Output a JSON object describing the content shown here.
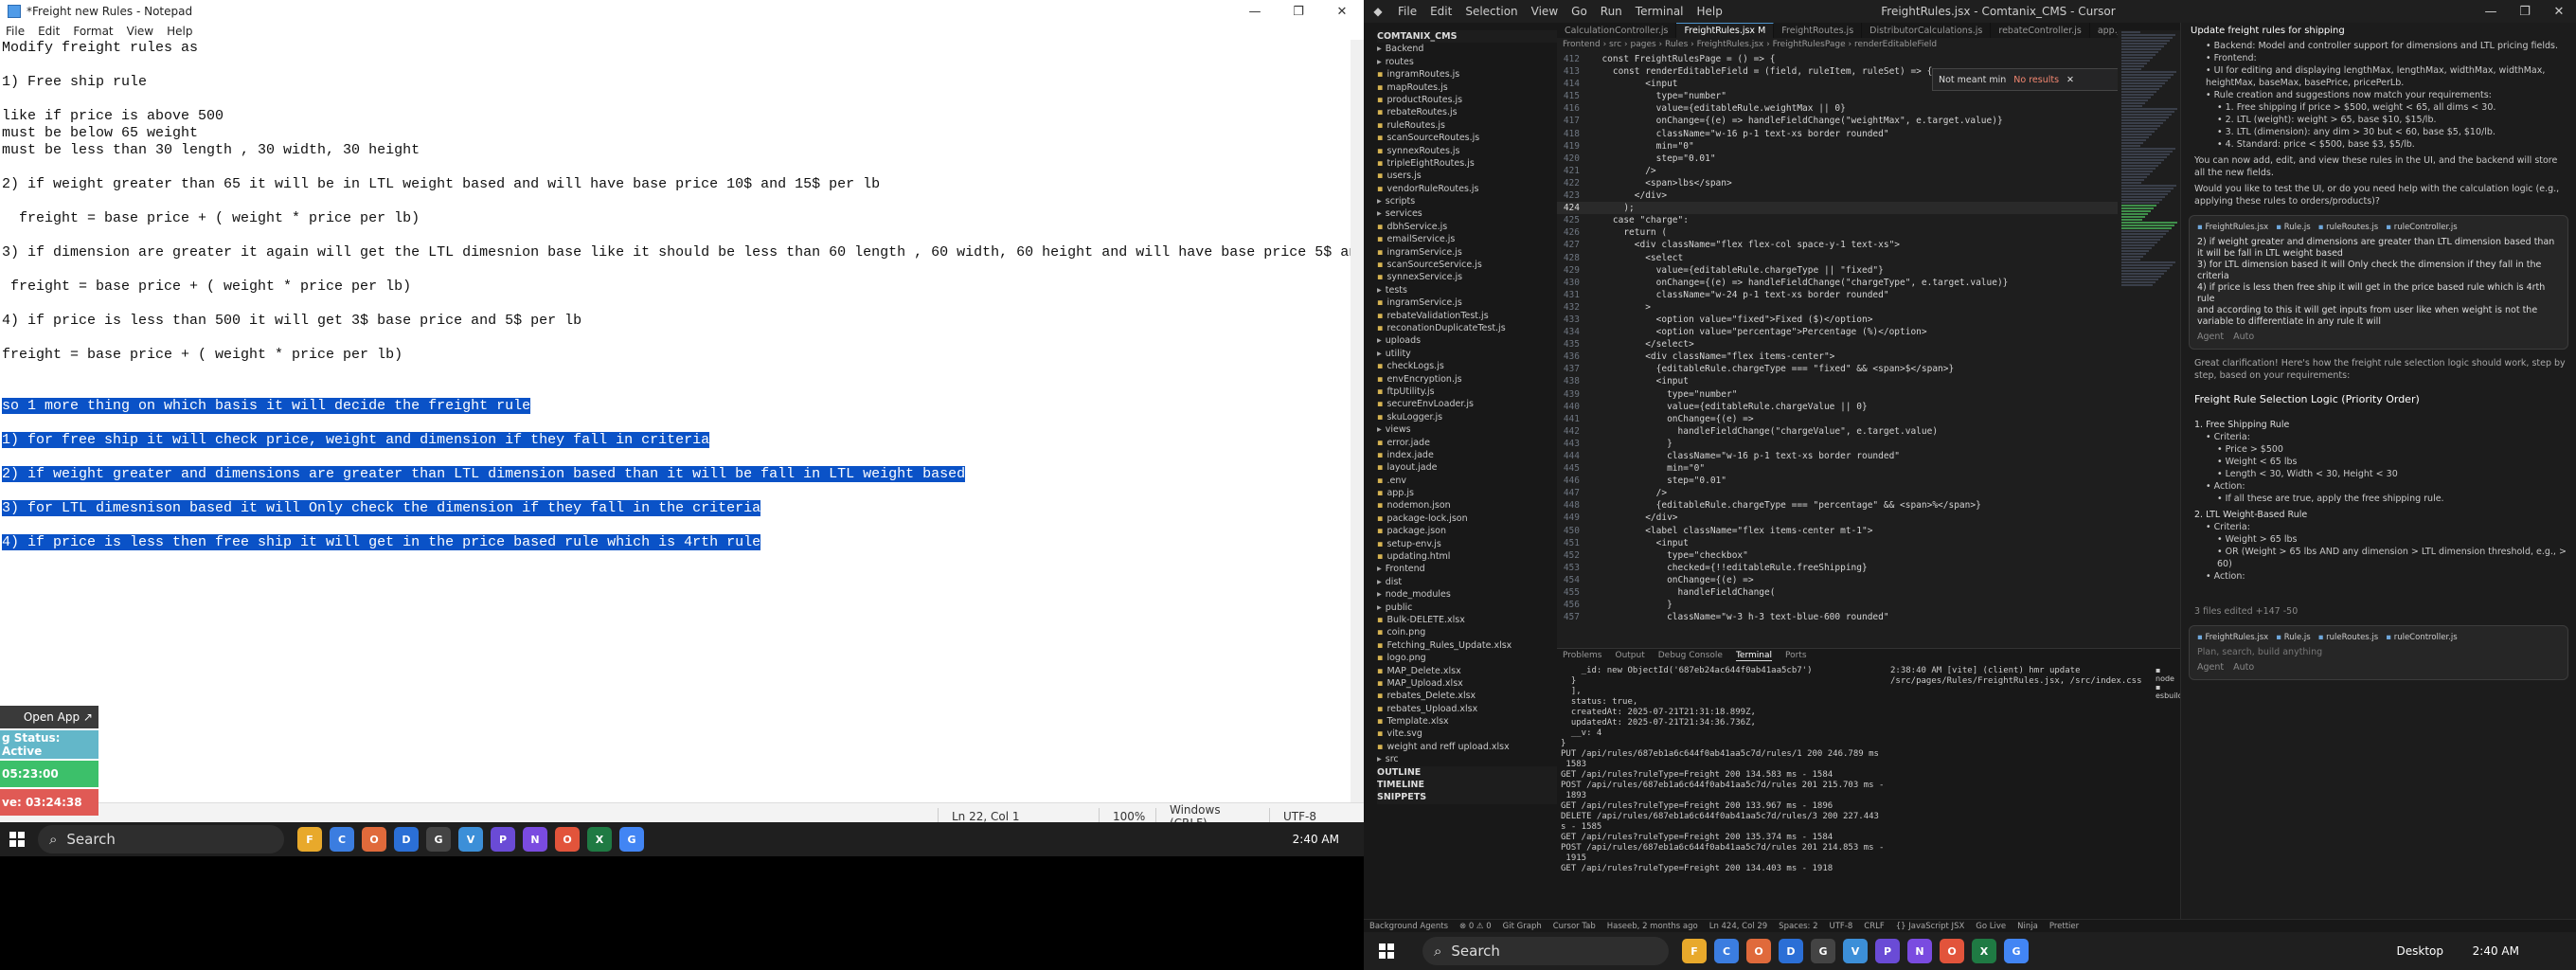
{
  "notepad": {
    "title": "*Freight new Rules - Notepad",
    "menu": [
      "File",
      "Edit",
      "Format",
      "View",
      "Help"
    ],
    "lines": [
      {
        "text": "Modify freight rules as",
        "selected": false
      },
      {
        "text": "",
        "selected": false
      },
      {
        "text": "1) Free ship rule",
        "selected": false
      },
      {
        "text": "",
        "selected": false
      },
      {
        "text": "like if price is above 500",
        "selected": false
      },
      {
        "text": "must be below 65 weight",
        "selected": false
      },
      {
        "text": "must be less than 30 length , 30 width, 30 height",
        "selected": false
      },
      {
        "text": "",
        "selected": false
      },
      {
        "text": "2) if weight greater than 65 it will be in LTL weight based and will have base price 10$ and 15$ per lb",
        "selected": false
      },
      {
        "text": "",
        "selected": false
      },
      {
        "text": "  freight = base price + ( weight * price per lb)",
        "selected": false
      },
      {
        "text": "",
        "selected": false
      },
      {
        "text": "3) if dimension are greater it again will get the LTL dimesnion base like it should be less than 60 length , 60 width, 60 height and will have base price 5$ and 10$ per lb",
        "selected": false
      },
      {
        "text": "",
        "selected": false
      },
      {
        "text": " freight = base price + ( weight * price per lb)",
        "selected": false
      },
      {
        "text": "",
        "selected": false
      },
      {
        "text": "4) if price is less than 500 it will get 3$ base price and 5$ per lb",
        "selected": false
      },
      {
        "text": "",
        "selected": false
      },
      {
        "text": "freight = base price + ( weight * price per lb)",
        "selected": false
      },
      {
        "text": "",
        "selected": false
      },
      {
        "text": "",
        "selected": false
      },
      {
        "text": "so 1 more thing on which basis it will decide the freight rule",
        "selected": true
      },
      {
        "text": "",
        "selected": false
      },
      {
        "text": "1) for free ship it will check price, weight and dimension if they fall in criteria",
        "selected": true
      },
      {
        "text": "",
        "selected": false
      },
      {
        "text": "2) if weight greater and dimensions are greater than LTL dimension based than it will be fall in LTL weight based",
        "selected": true
      },
      {
        "text": "",
        "selected": false
      },
      {
        "text": "3) for LTL dimesnison based it will Only check the dimension if they fall in the criteria",
        "selected": true
      },
      {
        "text": "",
        "selected": false
      },
      {
        "text": "4) if price is less then free ship it will get in the price based rule which is 4rth rule",
        "selected": true
      }
    ],
    "status": {
      "position": "Ln 22, Col 1",
      "zoom": "100%",
      "eol": "Windows (CRLF)",
      "encoding": "UTF-8"
    }
  },
  "widget": {
    "open_app": "Open App ↗",
    "status": "g Status: Active",
    "time_green": "05:23:00",
    "time_red": "ve: 03:24:38"
  },
  "left_taskbar": {
    "search": "Search",
    "clock": "2:40 AM",
    "apps": [
      {
        "label": "F",
        "color": "#e8a92b"
      },
      {
        "label": "C",
        "color": "#3b7de0"
      },
      {
        "label": "O",
        "color": "#e06a3b"
      },
      {
        "label": "D",
        "color": "#2b6fd6"
      },
      {
        "label": "G",
        "color": "#444444"
      },
      {
        "label": "V",
        "color": "#3c8fd8"
      },
      {
        "label": "P",
        "color": "#6a4bd6"
      },
      {
        "label": "N",
        "color": "#7a4be0"
      },
      {
        "label": "O",
        "color": "#e2543b"
      },
      {
        "label": "X",
        "color": "#1f7a43"
      },
      {
        "label": "G",
        "color": "#4285f4"
      }
    ]
  },
  "cursor": {
    "menu": [
      "File",
      "Edit",
      "Selection",
      "View",
      "Go",
      "Run",
      "Terminal",
      "Help"
    ],
    "title": "FreightRules.jsx - Comtanix_CMS - Cursor",
    "tabs": [
      {
        "label": "CalculationController.js",
        "active": false
      },
      {
        "label": "FreightRules.jsx M",
        "active": true
      },
      {
        "label": "FreightRoutes.js",
        "active": false
      },
      {
        "label": "DistributorCalculations.js",
        "active": false
      },
      {
        "label": "rebateController.js",
        "active": false
      },
      {
        "label": "app.js",
        "active": false
      }
    ],
    "breadcrumb": "Frontend › src › pages › Rules › FreightRules.jsx › FreightRulesPage › renderEditableField",
    "find_text": "Not meant min",
    "find_result": "No results",
    "code": [
      {
        "n": "412",
        "t": "  const FreightRulesPage = () => {"
      },
      {
        "n": "413",
        "t": "    const renderEditableField = (field, ruleItem, ruleSet) => {"
      },
      {
        "n": "414",
        "t": "          <input"
      },
      {
        "n": "415",
        "t": "            type=\"number\""
      },
      {
        "n": "416",
        "t": "            value={editableRule.weightMax || 0}"
      },
      {
        "n": "417",
        "t": "            onChange={(e) => handleFieldChange(\"weightMax\", e.target.value)}"
      },
      {
        "n": "418",
        "t": "            className=\"w-16 p-1 text-xs border rounded\""
      },
      {
        "n": "419",
        "t": "            min=\"0\""
      },
      {
        "n": "420",
        "t": "            step=\"0.01\""
      },
      {
        "n": "421",
        "t": "          />"
      },
      {
        "n": "422",
        "t": "          <span>lbs</span>"
      },
      {
        "n": "423",
        "t": "        </div>"
      },
      {
        "n": "424",
        "t": "      );"
      },
      {
        "n": "425",
        "t": "    case \"charge\":"
      },
      {
        "n": "426",
        "t": "      return ("
      },
      {
        "n": "427",
        "t": "        <div className=\"flex flex-col space-y-1 text-xs\">"
      },
      {
        "n": "428",
        "t": "          <select"
      },
      {
        "n": "429",
        "t": "            value={editableRule.chargeType || \"fixed\"}"
      },
      {
        "n": "430",
        "t": "            onChange={(e) => handleFieldChange(\"chargeType\", e.target.value)}"
      },
      {
        "n": "431",
        "t": "            className=\"w-24 p-1 text-xs border rounded\""
      },
      {
        "n": "432",
        "t": "          >"
      },
      {
        "n": "433",
        "t": "            <option value=\"fixed\">Fixed ($)</option>"
      },
      {
        "n": "434",
        "t": "            <option value=\"percentage\">Percentage (%)</option>"
      },
      {
        "n": "435",
        "t": "          </select>"
      },
      {
        "n": "436",
        "t": "          <div className=\"flex items-center\">"
      },
      {
        "n": "437",
        "t": "            {editableRule.chargeType === \"fixed\" && <span>$</span>}"
      },
      {
        "n": "438",
        "t": "            <input"
      },
      {
        "n": "439",
        "t": "              type=\"number\""
      },
      {
        "n": "440",
        "t": "              value={editableRule.chargeValue || 0}"
      },
      {
        "n": "441",
        "t": "              onChange={(e) =>"
      },
      {
        "n": "442",
        "t": "                handleFieldChange(\"chargeValue\", e.target.value)"
      },
      {
        "n": "443",
        "t": "              }"
      },
      {
        "n": "444",
        "t": "              className=\"w-16 p-1 text-xs border rounded\""
      },
      {
        "n": "445",
        "t": "              min=\"0\""
      },
      {
        "n": "446",
        "t": "              step=\"0.01\""
      },
      {
        "n": "447",
        "t": "            />"
      },
      {
        "n": "448",
        "t": "            {editableRule.chargeType === \"percentage\" && <span>%</span>}"
      },
      {
        "n": "449",
        "t": "          </div>"
      },
      {
        "n": "450",
        "t": "          <label className=\"flex items-center mt-1\">"
      },
      {
        "n": "451",
        "t": "            <input"
      },
      {
        "n": "452",
        "t": "              type=\"checkbox\""
      },
      {
        "n": "453",
        "t": "              checked={!!editableRule.freeShipping}"
      },
      {
        "n": "454",
        "t": "              onChange={(e) =>"
      },
      {
        "n": "455",
        "t": "                handleFieldChange("
      },
      {
        "n": "456",
        "t": "              }"
      },
      {
        "n": "457",
        "t": "              className=\"w-3 h-3 text-blue-600 rounded\""
      }
    ],
    "explorer": [
      {
        "t": "COMTANIX_CMS",
        "k": "section"
      },
      {
        "t": "Backend",
        "k": "folder"
      },
      {
        "t": "routes",
        "k": "folder"
      },
      {
        "t": "ingramRoutes.js",
        "k": "file"
      },
      {
        "t": "mapRoutes.js",
        "k": "file"
      },
      {
        "t": "productRoutes.js",
        "k": "file"
      },
      {
        "t": "rebateRoutes.js",
        "k": "file"
      },
      {
        "t": "ruleRoutes.js",
        "k": "file"
      },
      {
        "t": "scanSourceRoutes.js",
        "k": "file"
      },
      {
        "t": "synnexRoutes.js",
        "k": "file"
      },
      {
        "t": "tripleEightRoutes.js",
        "k": "file"
      },
      {
        "t": "users.js",
        "k": "file"
      },
      {
        "t": "vendorRuleRoutes.js",
        "k": "file"
      },
      {
        "t": "scripts",
        "k": "folder"
      },
      {
        "t": "services",
        "k": "folder"
      },
      {
        "t": "dbhService.js",
        "k": "file"
      },
      {
        "t": "emailService.js",
        "k": "file"
      },
      {
        "t": "ingramService.js",
        "k": "file"
      },
      {
        "t": "scanSourceService.js",
        "k": "file"
      },
      {
        "t": "synnexService.js",
        "k": "file"
      },
      {
        "t": "tests",
        "k": "folder"
      },
      {
        "t": "ingramService.js",
        "k": "file"
      },
      {
        "t": "rebateValidationTest.js",
        "k": "file"
      },
      {
        "t": "reconationDuplicateTest.js",
        "k": "file"
      },
      {
        "t": "uploads",
        "k": "folder"
      },
      {
        "t": "utility",
        "k": "folder"
      },
      {
        "t": "checkLogs.js",
        "k": "file"
      },
      {
        "t": "envEncryption.js",
        "k": "file"
      },
      {
        "t": "ftpUtility.js",
        "k": "file"
      },
      {
        "t": "secureEnvLoader.js",
        "k": "file"
      },
      {
        "t": "skuLogger.js",
        "k": "file"
      },
      {
        "t": "views",
        "k": "folder"
      },
      {
        "t": "error.jade",
        "k": "file"
      },
      {
        "t": "index.jade",
        "k": "file"
      },
      {
        "t": "layout.jade",
        "k": "file"
      },
      {
        "t": ".env",
        "k": "file"
      },
      {
        "t": "app.js",
        "k": "file"
      },
      {
        "t": "nodemon.json",
        "k": "file"
      },
      {
        "t": "package-lock.json",
        "k": "file"
      },
      {
        "t": "package.json",
        "k": "file"
      },
      {
        "t": "setup-env.js",
        "k": "file"
      },
      {
        "t": "updating.html",
        "k": "file"
      },
      {
        "t": "Frontend",
        "k": "folder"
      },
      {
        "t": "dist",
        "k": "folder"
      },
      {
        "t": "node_modules",
        "k": "folder"
      },
      {
        "t": "public",
        "k": "folder"
      },
      {
        "t": "Bulk-DELETE.xlsx",
        "k": "file"
      },
      {
        "t": "coin.png",
        "k": "file"
      },
      {
        "t": "Fetching_Rules_Update.xlsx",
        "k": "file"
      },
      {
        "t": "logo.png",
        "k": "file"
      },
      {
        "t": "MAP_Delete.xlsx",
        "k": "file"
      },
      {
        "t": "MAP_Upload.xlsx",
        "k": "file"
      },
      {
        "t": "rebates_Delete.xlsx",
        "k": "file"
      },
      {
        "t": "rebates_Upload.xlsx",
        "k": "file"
      },
      {
        "t": "Template.xlsx",
        "k": "file"
      },
      {
        "t": "vite.svg",
        "k": "file"
      },
      {
        "t": "weight and reff upload.xlsx",
        "k": "file"
      },
      {
        "t": "src",
        "k": "folder"
      },
      {
        "t": "OUTLINE",
        "k": "section"
      },
      {
        "t": "TIMELINE",
        "k": "section"
      },
      {
        "t": "SNIPPETS",
        "k": "section"
      }
    ],
    "panel_tabs": [
      "Problems",
      "Output",
      "Debug Console",
      "Terminal",
      "Ports"
    ],
    "terminal_left": [
      "    _id: new ObjectId('687eb24ac644f0ab41aa5cb7')",
      "  }",
      "  ],",
      "  status: true,",
      "  createdAt: 2025-07-21T21:31:18.899Z,",
      "  updatedAt: 2025-07-21T21:34:36.736Z,",
      "  __v: 4",
      "}",
      "PUT /api/rules/687eb1a6c644f0ab41aa5c7d/rules/1 200 246.789 ms -",
      " 1583",
      "GET /api/rules?ruleType=Freight 200 134.583 ms - 1584",
      "POST /api/rules/687eb1a6c644f0ab41aa5c7d/rules 201 215.703 ms -",
      " 1893",
      "GET /api/rules?ruleType=Freight 200 133.967 ms - 1896",
      "DELETE /api/rules/687eb1a6c644f0ab41aa5c7d/rules/3 200 227.443 m",
      "s - 1585",
      "GET /api/rules?ruleType=Freight 200 135.374 ms - 1584",
      "POST /api/rules/687eb1a6c644f0ab41aa5c7d/rules 201 214.853 ms -",
      " 1915",
      "GET /api/rules?ruleType=Freight 200 134.403 ms - 1918"
    ],
    "terminal_right": "2:38:40 AM [vite] (client) hmr update /src/pages/Rules/FreightRules.jsx, /src/index.css",
    "chat": {
      "title": "Update freight rules for shipping",
      "summary": [
        "Backend: Model and controller support for dimensions and LTL pricing fields.",
        "Frontend:",
        "UI for editing and displaying lengthMax, lengthMax, widthMax, widthMax, heightMax, baseMax, basePrice, pricePerLb.",
        "Rule creation and suggestions now match your requirements:",
        "1. Free shipping if price > $500, weight < 65, all dims < 30.",
        "2. LTL (weight): weight > 65, base $10, $15/lb.",
        "3. LTL (dimension): any dim > 30 but < 60, base $5, $10/lb.",
        "4. Standard: price < $500, base $3, $5/lb."
      ],
      "note": "You can now add, edit, and view these rules in the UI, and the backend will store all the new fields.",
      "question": "Would you like to test the UI, or do you need help with the calculation logic (e.g., applying these rules to orders/products)?",
      "input_lines": [
        "2) if weight greater and dimensions are greater than LTL dimension based than it will be fall in LTL weight based",
        "3) for LTL dimension based it will Only check the dimension if they fall in the criteria",
        "4) if price is less then free ship it will get in the price based rule which is 4rth rule",
        "and according to this it will get inputs from user like when weight is not the variable to differentiate in any rule it will"
      ],
      "chips": [
        "FreightRules.jsx",
        "Rule.js",
        "ruleRoutes.js",
        "ruleController.js"
      ],
      "answer_intro": "Great clarification! Here's how the freight rule selection logic should work, step by step, based on your requirements:",
      "answer_heading": "Freight Rule Selection Logic (Priority Order)",
      "answer_lines": [
        {
          "t": "1. Free Shipping Rule",
          "l": 0
        },
        {
          "t": "Criteria:",
          "l": 1
        },
        {
          "t": "Price > $500",
          "l": 2
        },
        {
          "t": "Weight < 65 lbs",
          "l": 2
        },
        {
          "t": "Length < 30, Width < 30, Height < 30",
          "l": 2
        },
        {
          "t": "Action:",
          "l": 1
        },
        {
          "t": "If all these are true, apply the free shipping rule.",
          "l": 2
        },
        {
          "t": "2. LTL Weight-Based Rule",
          "l": 0
        },
        {
          "t": "Criteria:",
          "l": 1
        },
        {
          "t": "Weight > 65 lbs",
          "l": 2
        },
        {
          "t": "OR (Weight > 65 lbs AND any dimension > LTL dimension threshold, e.g., > 60)",
          "l": 2
        },
        {
          "t": "Action:",
          "l": 1
        }
      ],
      "files_edited": "3 files edited +147 -50",
      "input_placeholder": "Plan, search, build anything",
      "agent_label": "Agent",
      "auto_label": "Auto"
    },
    "statusbar": [
      "Background Agents",
      "⊗ 0 ⚠ 0",
      "Git Graph",
      "Cursor Tab",
      "Haseeb, 2 months ago",
      "Ln 424, Col 29",
      "Spaces: 2",
      "UTF-8",
      "CRLF",
      "{} JavaScript JSX",
      "Go Live",
      "Ninja",
      "Prettier"
    ],
    "taskbar": {
      "search": "Search",
      "desktop": "Desktop",
      "clock": "2:40 AM"
    }
  }
}
